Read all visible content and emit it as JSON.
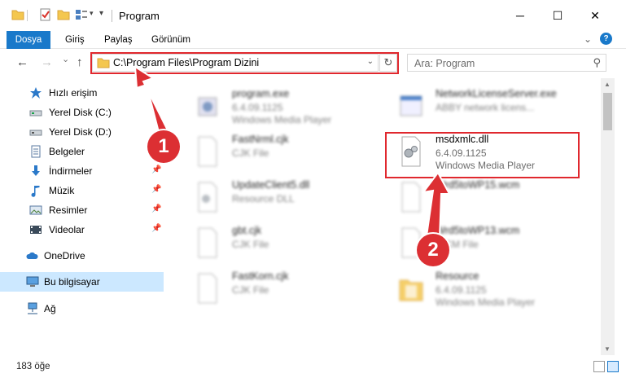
{
  "window": {
    "title": "Program",
    "minimize_glyph": "─",
    "maximize_glyph": "☐",
    "close_glyph": "✕"
  },
  "ribbon": {
    "tabs": [
      "Dosya",
      "Giriş",
      "Paylaş",
      "Görünüm"
    ],
    "expand_glyph": "⌄",
    "help_glyph": "?"
  },
  "nav": {
    "back_glyph": "←",
    "forward_glyph": "→",
    "recent_glyph": "⌄",
    "up_glyph": "↑",
    "path": "C:\\Program Files\\Program Dizini",
    "dropdown_glyph": "⌄",
    "refresh_glyph": "↻"
  },
  "search": {
    "placeholder": "Ara: Program",
    "icon_glyph": "⚲"
  },
  "sidebar": {
    "items": [
      {
        "label": "Hızlı erişim",
        "icon": "star-icon",
        "pinned": false
      },
      {
        "label": "Yerel Disk (C:)",
        "icon": "drive-icon",
        "pinned": true
      },
      {
        "label": "Yerel Disk (D:)",
        "icon": "drive-icon",
        "pinned": false
      },
      {
        "label": "Belgeler",
        "icon": "documents-icon",
        "pinned": true
      },
      {
        "label": "İndirmeler",
        "icon": "downloads-icon",
        "pinned": true
      },
      {
        "label": "Müzik",
        "icon": "music-icon",
        "pinned": true
      },
      {
        "label": "Resimler",
        "icon": "pictures-icon",
        "pinned": true
      },
      {
        "label": "Videolar",
        "icon": "videos-icon",
        "pinned": true
      },
      {
        "label": "OneDrive",
        "icon": "cloud-icon",
        "pinned": false
      },
      {
        "label": "Bu bilgisayar",
        "icon": "computer-icon",
        "pinned": false
      },
      {
        "label": "Ağ",
        "icon": "network-icon",
        "pinned": false
      }
    ],
    "pin_glyph": "📌"
  },
  "files": [
    {
      "name": "program.exe",
      "line2": "6.4.09.1125",
      "line3": "Windows Media Player",
      "icon": "exe-icon"
    },
    {
      "name": "NetworkLicenseServer.exe",
      "line2": "ABBY network licens...",
      "line3": "",
      "icon": "exe-icon"
    },
    {
      "name": "FastNrml.cjk",
      "line2": "CJK File",
      "line3": "",
      "icon": "file-icon"
    },
    {
      "name": "msdxmlc.dll",
      "line2": "6.4.09.1125",
      "line3": "Windows Media Player",
      "icon": "dll-icon"
    },
    {
      "name": "UpdateClient5.dll",
      "line2": "Resource DLL",
      "line3": "",
      "icon": "dll-icon"
    },
    {
      "name": "Wrd5toWP15.wcm",
      "line2": "",
      "line3": "",
      "icon": "file-icon"
    },
    {
      "name": "gbt.cjk",
      "line2": "CJK File",
      "line3": "",
      "icon": "file-icon"
    },
    {
      "name": "Wrd5toWP13.wcm",
      "line2": "WCM File",
      "line3": "",
      "icon": "file-icon"
    },
    {
      "name": "FastKorn.cjk",
      "line2": "CJK File",
      "line3": "",
      "icon": "file-icon"
    },
    {
      "name": "Resource",
      "line2": "6.4.09.1125",
      "line3": "Windows Media Player",
      "icon": "folder-icon"
    }
  ],
  "status": {
    "count": "183 öğe"
  },
  "annotations": {
    "step1": "1",
    "step2": "2",
    "color": "#dc2f33"
  },
  "colors": {
    "accent": "#1979ca",
    "selection": "#cce8ff",
    "highlight": "#e0282e"
  }
}
